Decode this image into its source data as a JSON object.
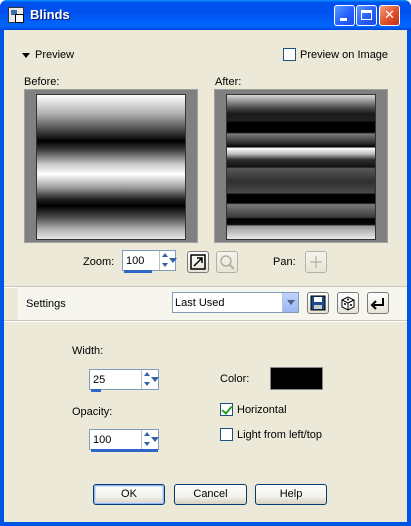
{
  "window": {
    "title": "Blinds",
    "buttons": {
      "minimize": "minimize",
      "maximize": "maximize",
      "close": "close"
    }
  },
  "preview": {
    "toggle_label": "Preview",
    "expanded": true,
    "preview_on_image_label": "Preview on Image",
    "preview_on_image_checked": false,
    "before_label": "Before:",
    "after_label": "After:"
  },
  "zoom": {
    "label": "Zoom:",
    "value": "100",
    "pan_label": "Pan:"
  },
  "settings": {
    "label": "Settings",
    "preset": "Last Used"
  },
  "params": {
    "width_label": "Width:",
    "width_value": "25",
    "opacity_label": "Opacity:",
    "opacity_value": "100",
    "color_label": "Color:",
    "color_value": "#000000",
    "horizontal_label": "Horizontal",
    "horizontal_checked": true,
    "light_label": "Light from left/top",
    "light_checked": false
  },
  "actions": {
    "ok": "OK",
    "cancel": "Cancel",
    "help": "Help"
  }
}
